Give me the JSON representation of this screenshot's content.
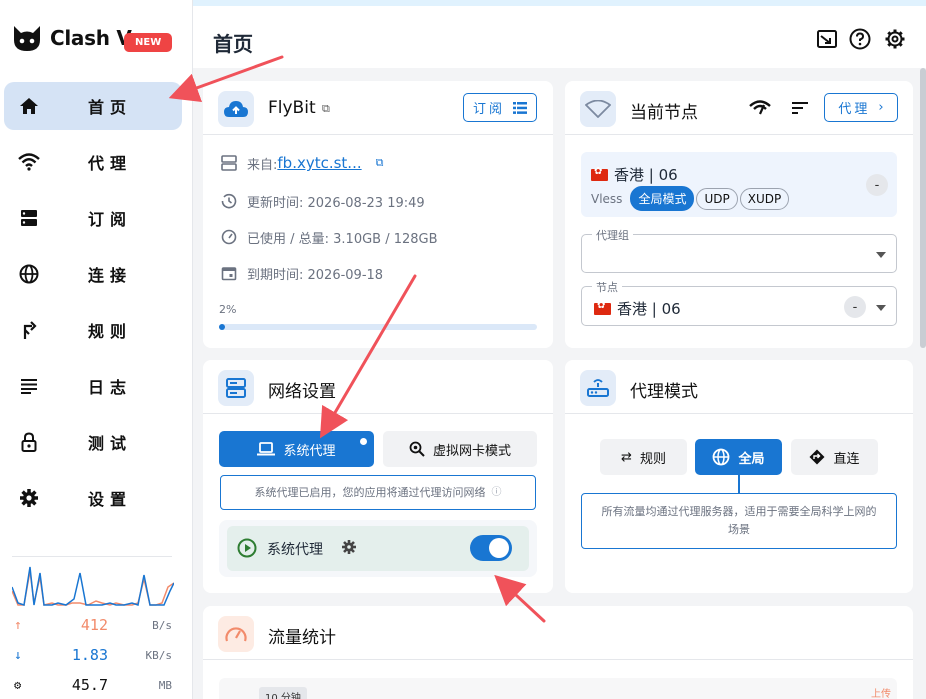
{
  "app": {
    "title": "Clash V",
    "badge": "NEW"
  },
  "sidebar": {
    "items": [
      {
        "label": "首页",
        "icon": "home-icon"
      },
      {
        "label": "代理",
        "icon": "wifi-icon"
      },
      {
        "label": "订阅",
        "icon": "storage-icon"
      },
      {
        "label": "连接",
        "icon": "globe-icon"
      },
      {
        "label": "规则",
        "icon": "fork-icon"
      },
      {
        "label": "日志",
        "icon": "list-icon"
      },
      {
        "label": "测试",
        "icon": "lock-icon"
      },
      {
        "label": "设置",
        "icon": "gear-icon"
      }
    ],
    "traffic": {
      "up": {
        "value": "412",
        "unit": "B/s",
        "color": "#f28b6b"
      },
      "down": {
        "value": "1.83",
        "unit": "KB/s",
        "color": "#1976d2"
      },
      "mem": {
        "value": "45.7",
        "unit": "MB",
        "color": "#111111"
      }
    }
  },
  "header": {
    "title": "首页"
  },
  "profile": {
    "name": "FlyBit",
    "subscribe_label": "订阅",
    "source_label": "来自: ",
    "source_link": "fb.xytc.st...",
    "updated": "更新时间: 2026-08-23 19:49",
    "usage": "已使用 / 总量: 3.10GB / 128GB",
    "expire": "到期时间: 2026-09-18",
    "percent_label": "2%",
    "percent": 0.02
  },
  "current_node": {
    "title": "当前节点",
    "proxy_button": "代理",
    "node_name": "香港 | 06",
    "protocol": "Vless",
    "tags": [
      "全局模式",
      "UDP",
      "XUDP"
    ],
    "delay_placeholder": "-",
    "group_label": "代理组",
    "group_value": "",
    "node_label": "节点",
    "node_value": "香港 | 06"
  },
  "network": {
    "title": "网络设置",
    "tab_system": "系统代理",
    "tab_tun": "虚拟网卡模式",
    "desc": "系统代理已启用，您的应用将通过代理访问网络",
    "switch_label": "系统代理",
    "switch_on": true
  },
  "proxy_mode": {
    "title": "代理模式",
    "modes": [
      "规则",
      "全局",
      "直连"
    ],
    "active": "全局",
    "desc_line1": "所有流量均通过代理服务器，适用于需要全局科学上网的",
    "desc_line2": "场景"
  },
  "traffic_stats": {
    "title": "流量统计",
    "range_tag": "10 分钟",
    "legend_up": "上传"
  },
  "colors": {
    "accent": "#1976d2",
    "sidebar_active": "#d5e3f5",
    "badge": "#ef4444",
    "annotation_arrow": "#f0525a"
  }
}
